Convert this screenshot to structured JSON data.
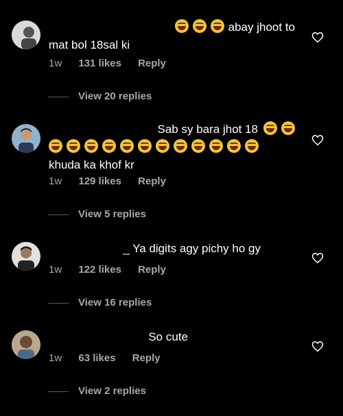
{
  "comments": [
    {
      "avatar": "avatar-1",
      "line1_prefix_emojis": 3,
      "line1": "abay jhoot to",
      "line2": "mat bol 18sal ki",
      "time": "1w",
      "likes": "131 likes",
      "reply": "Reply",
      "view_replies": "View 20 replies"
    },
    {
      "avatar": "avatar-2",
      "line1": "Sab sy bara jhot 18",
      "line1_suffix_emojis": 2,
      "line2_emojis": 12,
      "line3": "khuda ka khof kr",
      "time": "1w",
      "likes": "129 likes",
      "reply": "Reply",
      "view_replies": "View 5 replies"
    },
    {
      "avatar": "avatar-3",
      "line1": "_ Ya digits agy pichy ho gy",
      "time": "1w",
      "likes": "122 likes",
      "reply": "Reply",
      "view_replies": "View 16 replies"
    },
    {
      "avatar": "avatar-4",
      "line1": "So cute",
      "time": "1w",
      "likes": "63 likes",
      "reply": "Reply",
      "view_replies": "View 2 replies"
    }
  ],
  "icons": {
    "like": "heart-outline-icon",
    "emoji_laugh": "rofl-emoji"
  },
  "colors": {
    "background": "#000000",
    "secondary_text": "#a8a8a8"
  }
}
